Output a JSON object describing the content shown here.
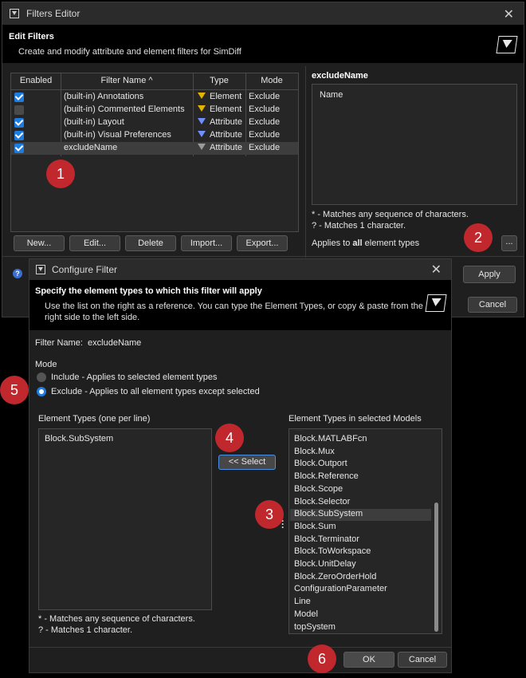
{
  "main_window": {
    "title": "Filters Editor",
    "header_title": "Edit Filters",
    "header_subtitle": "Create and modify attribute and element filters for SimDiff",
    "table": {
      "columns": [
        "Enabled",
        "Filter Name ^",
        "Type",
        "Mode"
      ],
      "rows": [
        {
          "enabled": true,
          "name": "(built-in) Annotations",
          "type": "Element",
          "mode": "Exclude"
        },
        {
          "enabled": false,
          "name": "(built-in) Commented Elements",
          "type": "Element",
          "mode": "Exclude"
        },
        {
          "enabled": true,
          "name": "(built-in) Layout",
          "type": "Attribute",
          "mode": "Exclude"
        },
        {
          "enabled": true,
          "name": "(built-in) Visual Preferences",
          "type": "Attribute",
          "mode": "Exclude"
        },
        {
          "enabled": true,
          "name": "excludeName",
          "type": "Attribute",
          "mode": "Exclude"
        }
      ]
    },
    "buttons": {
      "new": "New...",
      "edit": "Edit...",
      "delete": "Delete",
      "import": "Import...",
      "export": "Export..."
    },
    "detail": {
      "title": "excludeName",
      "content": "Name",
      "hint1": "* - Matches any sequence of characters.",
      "hint2": "? - Matches 1 character.",
      "applies_prefix": "Applies to ",
      "applies_bold": "all",
      "applies_suffix": " element types",
      "dots_button": "..."
    },
    "apply_button": "Apply",
    "cancel_button": "Cancel"
  },
  "configure_dialog": {
    "title": "Configure Filter",
    "header_title": "Specify the element types to which this filter will apply",
    "header_line1": "Use the list on the right as a reference. You can type the Element Types, or copy & paste from the",
    "header_line2": "right side to the left side.",
    "filter_name_label": "Filter Name:",
    "filter_name_value": "excludeName",
    "mode_label": "Mode",
    "include_option": "Include - Applies to selected element types",
    "exclude_option": "Exclude - Applies to all element types except selected",
    "mode_selected": "exclude",
    "left_list_label": "Element Types (one per line)",
    "left_list_value": "Block.SubSystem",
    "select_button": "<< Select",
    "right_list_label": "Element Types in selected Models",
    "right_list_items": [
      "Block.MATLABFcn",
      "Block.Mux",
      "Block.Outport",
      "Block.Reference",
      "Block.Scope",
      "Block.Selector",
      "Block.SubSystem",
      "Block.Sum",
      "Block.Terminator",
      "Block.ToWorkspace",
      "Block.UnitDelay",
      "Block.ZeroOrderHold",
      "ConfigurationParameter",
      "Line",
      "Model",
      "topSystem"
    ],
    "right_list_selected": "Block.SubSystem",
    "hint1": "* - Matches any sequence of characters.",
    "hint2": "? - Matches 1 character.",
    "ok_button": "OK",
    "cancel_button": "Cancel"
  },
  "markers": [
    "1",
    "2",
    "3",
    "4",
    "5",
    "6"
  ],
  "colors": {
    "marker": "#c0282e",
    "accent": "#1e7be0"
  }
}
